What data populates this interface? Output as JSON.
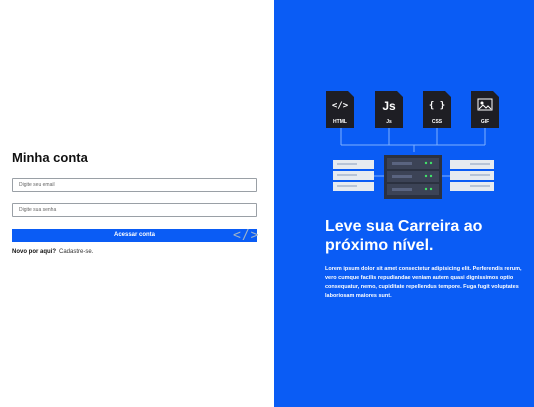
{
  "login": {
    "title": "Minha conta",
    "email_placeholder": "Digite seu email",
    "password_placeholder": "Digite sua senha",
    "submit_label": "Acessar conta",
    "signup_prompt": "Novo por aqui?",
    "signup_link": "Cadastre-se."
  },
  "decor": {
    "code_glyph": "</>"
  },
  "hero": {
    "headline": "Leve sua Carreira ao próximo nível.",
    "body": "Lorem ipsum dolor sit amet consectetur adipisicing elit. Perferendis rerum, vero cumque facilis repudiandae veniam autem quasi dignissimos optio consequatur, nemo, cupiditate repellendus tempore. Fuga fugit voluptates laboriosam maiores sunt.",
    "files": [
      {
        "icon": "html-file-icon",
        "glyph": "</>",
        "label": "HTML"
      },
      {
        "icon": "js-file-icon",
        "glyph": "Js",
        "label": "Js"
      },
      {
        "icon": "css-file-icon",
        "glyph": "{ }",
        "label": "CSS"
      },
      {
        "icon": "gif-file-icon",
        "glyph": "",
        "label": "GIF"
      }
    ]
  },
  "colors": {
    "accent": "#0a5cf5",
    "file_dark": "#1e1e24",
    "server_gray": "#e6ebf0"
  }
}
